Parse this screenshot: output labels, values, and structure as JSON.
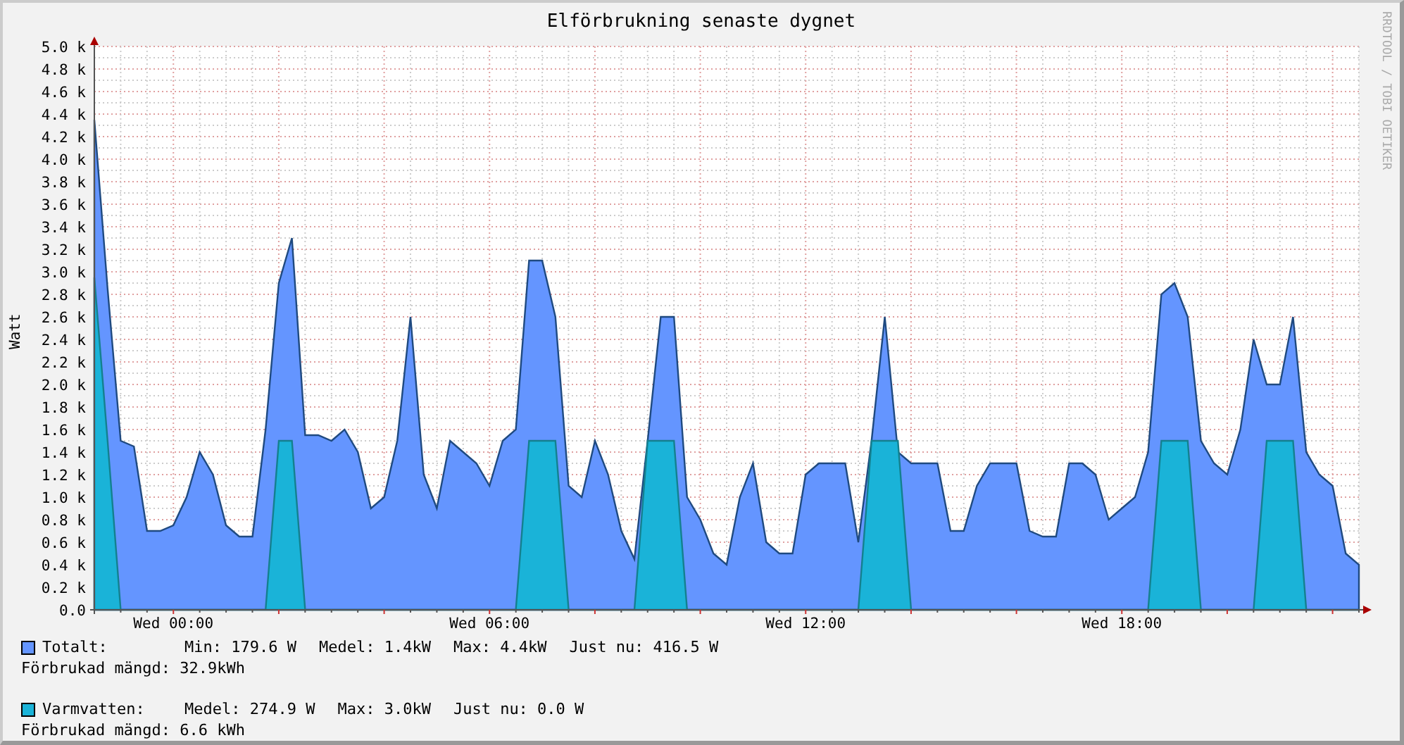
{
  "chart": {
    "title": "Elförbrukning senaste dygnet",
    "side_label": "RRDTOOL / TOBI OETIKER",
    "chart_data": {
      "type": "area",
      "ylabel": "Watt",
      "ylim": [
        0,
        5000
      ],
      "stacked": false,
      "grid": true,
      "yticks": [
        {
          "value": 0,
          "label": "0.0"
        },
        {
          "value": 200,
          "label": "0.2 k"
        },
        {
          "value": 400,
          "label": "0.4 k"
        },
        {
          "value": 600,
          "label": "0.6 k"
        },
        {
          "value": 800,
          "label": "0.8 k"
        },
        {
          "value": 1000,
          "label": "1.0 k"
        },
        {
          "value": 1200,
          "label": "1.2 k"
        },
        {
          "value": 1400,
          "label": "1.4 k"
        },
        {
          "value": 1600,
          "label": "1.6 k"
        },
        {
          "value": 1800,
          "label": "1.8 k"
        },
        {
          "value": 2000,
          "label": "2.0 k"
        },
        {
          "value": 2200,
          "label": "2.2 k"
        },
        {
          "value": 2400,
          "label": "2.4 k"
        },
        {
          "value": 2600,
          "label": "2.6 k"
        },
        {
          "value": 2800,
          "label": "2.8 k"
        },
        {
          "value": 3000,
          "label": "3.0 k"
        },
        {
          "value": 3200,
          "label": "3.2 k"
        },
        {
          "value": 3400,
          "label": "3.4 k"
        },
        {
          "value": 3600,
          "label": "3.6 k"
        },
        {
          "value": 3800,
          "label": "3.8 k"
        },
        {
          "value": 4000,
          "label": "4.0 k"
        },
        {
          "value": 4200,
          "label": "4.2 k"
        },
        {
          "value": 4400,
          "label": "4.4 k"
        },
        {
          "value": 4600,
          "label": "4.6 k"
        },
        {
          "value": 4800,
          "label": "4.8 k"
        },
        {
          "value": 5000,
          "label": "5.0 k"
        }
      ],
      "categories": [
        null,
        null,
        null,
        null,
        null,
        null,
        "Wed 00:00",
        null,
        null,
        null,
        null,
        null,
        null,
        null,
        null,
        null,
        null,
        null,
        null,
        null,
        null,
        null,
        null,
        null,
        null,
        null,
        null,
        null,
        null,
        null,
        "Wed 06:00",
        null,
        null,
        null,
        null,
        null,
        null,
        null,
        null,
        null,
        null,
        null,
        null,
        null,
        null,
        null,
        null,
        null,
        null,
        null,
        null,
        null,
        null,
        null,
        "Wed 12:00",
        null,
        null,
        null,
        null,
        null,
        null,
        null,
        null,
        null,
        null,
        null,
        null,
        null,
        null,
        null,
        null,
        null,
        null,
        null,
        null,
        null,
        null,
        null,
        "Wed 18:00",
        null,
        null,
        null,
        null,
        null,
        null,
        null,
        null,
        null,
        null,
        null,
        null,
        null,
        null,
        null,
        null,
        null,
        null
      ],
      "series": [
        {
          "name": "Totalt:",
          "color": "#6495ff",
          "values": [
            4350,
            2850,
            1500,
            1450,
            700,
            700,
            750,
            1000,
            1400,
            1200,
            750,
            650,
            650,
            1600,
            2900,
            3300,
            1550,
            1550,
            1500,
            1600,
            1400,
            900,
            1000,
            1500,
            2600,
            1200,
            900,
            1500,
            1400,
            1300,
            1100,
            1500,
            1600,
            3100,
            3100,
            2600,
            1100,
            1000,
            1500,
            1200,
            700,
            450,
            1500,
            2600,
            2600,
            1000,
            800,
            500,
            400,
            1000,
            1300,
            600,
            500,
            500,
            1200,
            1300,
            1300,
            1300,
            600,
            1500,
            2600,
            1400,
            1300,
            1300,
            1300,
            700,
            700,
            1100,
            1300,
            1300,
            1300,
            700,
            650,
            650,
            1300,
            1300,
            1200,
            800,
            900,
            1000,
            1400,
            2800,
            2900,
            2600,
            1500,
            1300,
            1200,
            1600,
            2400,
            2000,
            2000,
            2600,
            1400,
            1200,
            1100,
            500,
            400
          ]
        },
        {
          "name": "Varmvatten:",
          "color": "#1ab3d8",
          "values": [
            2950,
            1500,
            0,
            0,
            0,
            0,
            0,
            0,
            0,
            0,
            0,
            0,
            0,
            0,
            1500,
            1500,
            0,
            0,
            0,
            0,
            0,
            0,
            0,
            0,
            0,
            0,
            0,
            0,
            0,
            0,
            0,
            0,
            0,
            1500,
            1500,
            1500,
            0,
            0,
            0,
            0,
            0,
            0,
            1500,
            1500,
            1500,
            0,
            0,
            0,
            0,
            0,
            0,
            0,
            0,
            0,
            0,
            0,
            0,
            0,
            0,
            1500,
            1500,
            1500,
            0,
            0,
            0,
            0,
            0,
            0,
            0,
            0,
            0,
            0,
            0,
            0,
            0,
            0,
            0,
            0,
            0,
            0,
            0,
            1500,
            1500,
            1500,
            0,
            0,
            0,
            0,
            0,
            1500,
            1500,
            1500,
            0,
            0,
            0,
            0,
            0
          ]
        }
      ]
    }
  },
  "legend": [
    {
      "stats": [
        "Min: 179.6 W",
        "Medel: 1.4kW",
        "Max: 4.4kW",
        "Just nu: 416.5 W"
      ],
      "total": "Förbrukad mängd: 32.9kWh"
    },
    {
      "stats": [
        "Medel: 274.9 W",
        "Max: 3.0kW",
        "Just nu: 0.0 W"
      ],
      "total": "Förbrukad mängd: 6.6 kWh"
    }
  ]
}
